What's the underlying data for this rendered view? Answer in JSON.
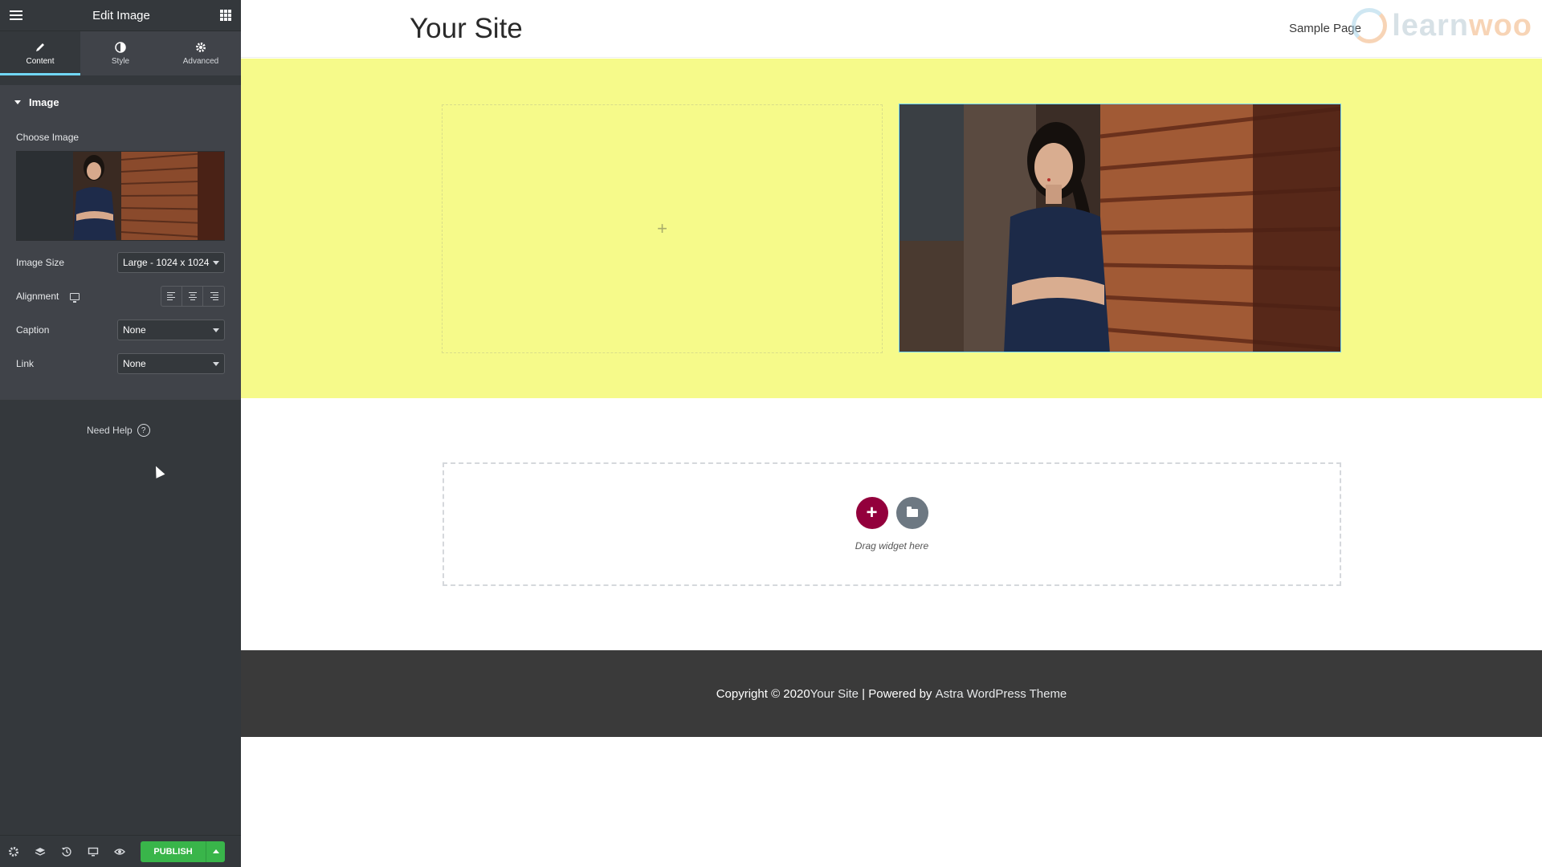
{
  "panel": {
    "title": "Edit Image",
    "tabs": [
      {
        "label": "Content",
        "icon": "pencil-icon"
      },
      {
        "label": "Style",
        "icon": "half-circle-icon"
      },
      {
        "label": "Advanced",
        "icon": "gear-icon"
      }
    ],
    "section_title": "Image",
    "choose_image_label": "Choose Image",
    "image_size": {
      "label": "Image Size",
      "value": "Large - 1024 x 1024"
    },
    "alignment": {
      "label": "Alignment"
    },
    "caption": {
      "label": "Caption",
      "value": "None"
    },
    "link": {
      "label": "Link",
      "value": "None"
    },
    "need_help": "Need Help",
    "help_glyph": "?",
    "publish_label": "PUBLISH"
  },
  "site": {
    "title": "Your Site",
    "menu_link": "Sample Page",
    "logo_text_a": "learn",
    "logo_text_b": "woo",
    "drag_text": "Drag widget here",
    "footer": {
      "copyright": "Copyright © 2020 ",
      "site_link": "Your Site",
      "separator": " | Powered by ",
      "theme_link": "Astra WordPress Theme"
    }
  },
  "colors": {
    "panel_bg": "#34383c",
    "accent": "#71d7f7",
    "publish_green": "#39b54a",
    "section_yellow": "#f6fa8a",
    "add_button": "#93003c",
    "footer_bg": "#3a3a3a"
  }
}
